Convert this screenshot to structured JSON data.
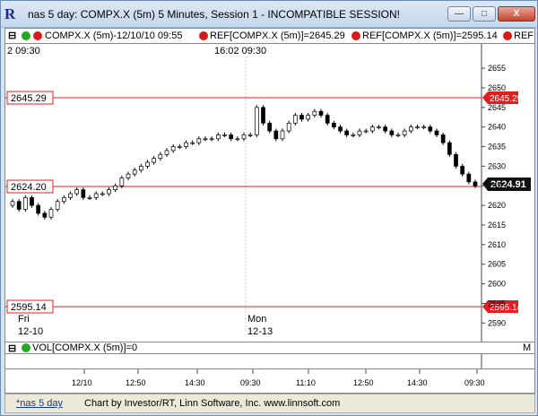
{
  "window": {
    "title": "nas 5 day: COMPX.X (5m) 5 Minutes, Session 1 - INCOMPATIBLE SESSION!",
    "icon": "R",
    "buttons": {
      "minimize": "—",
      "maximize": "□",
      "close": "X"
    }
  },
  "legend": {
    "symbol": "COMPX.X (5m)-12/10/10 09:55",
    "ref1": "REF[COMPX.X (5m)]=2645.29",
    "ref2": "REF[COMPX.X (5m)]=2595.14",
    "ref3": "REF",
    "pane_label": "M",
    "colors": {
      "green": "#22a822",
      "red": "#d81a1a"
    }
  },
  "top_time_labels": [
    "2  09:30",
    "16:02  09:30"
  ],
  "day_labels": {
    "fri": "Fri",
    "fri_date": "12-10",
    "mon": "Mon",
    "mon_date": "12-13"
  },
  "price_axis_ticks": [
    "2655",
    "2650",
    "2645",
    "2640",
    "2635",
    "2630",
    "2625",
    "2620",
    "2615",
    "2610",
    "2605",
    "2600",
    "2595",
    "2590"
  ],
  "ref_lines": {
    "upper": "2645.29",
    "mid": "2624.20",
    "lower": "2595.14",
    "last_price": "2624.91"
  },
  "volume": {
    "label": "VOL[COMPX.X (5m)]=0",
    "pane_label": "M"
  },
  "time_axis_ticks": [
    "12/10",
    "12:50",
    "14:30",
    "09:30",
    "11:10",
    "12:50",
    "14:30",
    "09:30"
  ],
  "status": {
    "tab": "*nas 5 day",
    "credit": "Chart by Investor/RT, Linn Software, Inc. www.linnsoft.com"
  },
  "chart_data": {
    "type": "candlestick",
    "y_range": [
      2588,
      2658
    ],
    "closes": [
      2621,
      2619,
      2622,
      2620,
      2618,
      2617,
      2619,
      2621,
      2622,
      2623,
      2624,
      2622,
      2622,
      2623,
      2623,
      2624,
      2625,
      2627,
      2628,
      2629,
      2630,
      2631,
      2632,
      2633,
      2634,
      2635,
      2635,
      2636,
      2636,
      2637,
      2637,
      2637,
      2638,
      2638,
      2637,
      2637,
      2638,
      2638,
      2645,
      2641,
      2639,
      2637,
      2639,
      2641,
      2643,
      2642,
      2643,
      2644,
      2643,
      2641,
      2640,
      2639,
      2638,
      2638,
      2639,
      2639,
      2640,
      2640,
      2639,
      2638,
      2638,
      2639,
      2640,
      2640,
      2640,
      2639,
      2638,
      2636,
      2633,
      2630,
      2628,
      2626,
      2625
    ]
  }
}
